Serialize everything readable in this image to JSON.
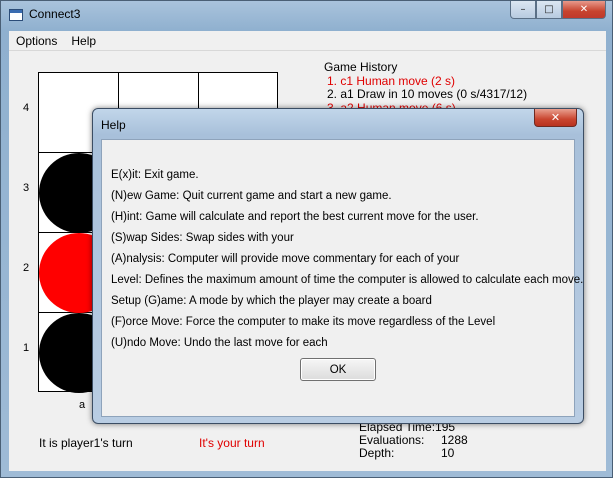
{
  "window": {
    "title": "Connect3",
    "min_glyph": "–",
    "max_glyph": "□",
    "close_glyph": "✕"
  },
  "menu": {
    "items": [
      "Options",
      "Help"
    ]
  },
  "board": {
    "rows": [
      "4",
      "3",
      "2",
      "1"
    ],
    "columns": [
      "a"
    ],
    "discs": [
      {
        "col": 0,
        "row": 3,
        "color": "black"
      },
      {
        "col": 0,
        "row": 2,
        "color": "red"
      },
      {
        "col": 0,
        "row": 1,
        "color": "black"
      }
    ]
  },
  "history": {
    "title": "Game History",
    "items": [
      {
        "text": "1. c1 Human move (2 s)",
        "style": "red"
      },
      {
        "text": "2. a1 Draw in 10 moves (0 s/4317/12)",
        "style": "black"
      },
      {
        "text": "3. a2 Human move (6 s)",
        "style": "red"
      }
    ]
  },
  "status": {
    "player": "It is player1's turn",
    "turn": "It's your turn"
  },
  "stats": {
    "elapsed": "Elapsed Time:195",
    "evaluations_label": "Evaluations:",
    "evaluations_value": "1288",
    "depth_label": "Depth:",
    "depth_value": "10"
  },
  "dialog": {
    "title": "Help",
    "close_glyph": "✕",
    "lines": [
      "E(x)it: Exit game.",
      "(N)ew Game: Quit current game and start a new game.",
      "(H)int: Game will calculate and report the best current move for the user.",
      "(S)wap Sides: Swap sides with your",
      "(A)nalysis: Computer will provide move commentary for each of your",
      "Level: Defines the maximum amount of time the computer is allowed to calculate each move.",
      "Setup (G)ame: A mode by which the player may create a board",
      "(F)orce Move: Force the computer to make its move regardless of the Level",
      "(U)ndo Move: Undo the last move for each"
    ],
    "ok_label": "OK"
  }
}
